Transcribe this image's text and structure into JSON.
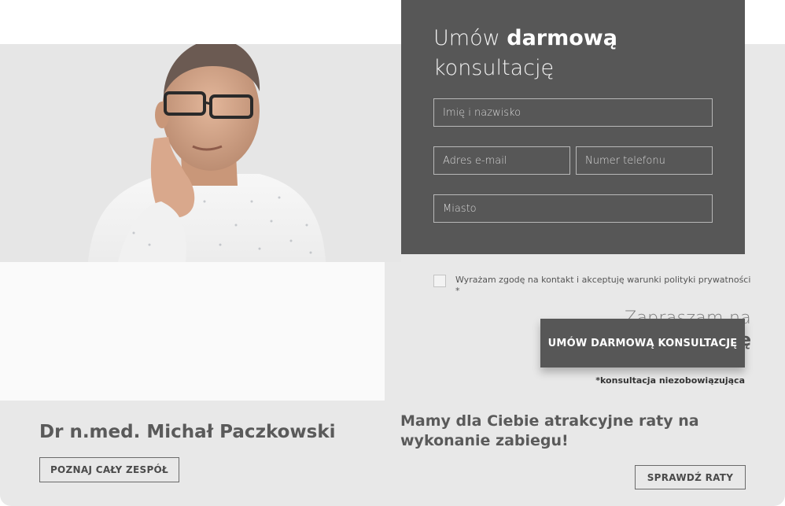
{
  "hero": {
    "invite_line1": "Zapraszam na",
    "invite_line2": "darmową konsultację",
    "doctor_name": "Dr n.med. Michał Paczkowski",
    "team_button": "POZNAJ CAŁY ZESPÓŁ"
  },
  "form": {
    "title_light": "Umów ",
    "title_bold": "darmową",
    "title_line2": "konsultację",
    "name_placeholder": "Imię i nazwisko",
    "email_placeholder": "Adres e-mail",
    "phone_placeholder": "Numer telefonu",
    "city_placeholder": "Miasto",
    "consent_text": "Wyrażam zgodę na kontakt i akceptuję warunki polityki prywatności *",
    "consent_checked": false,
    "submit_label": "UMÓW DARMOWĄ KONSULTACJĘ",
    "note": "*konsultacja niezobowiązująca"
  },
  "financing": {
    "text": "Mamy dla Ciebie atrakcyjne raty na wykonanie zabiegu!",
    "button": "SPRAWDŹ RATY"
  },
  "colors": {
    "form_bg": "#575757",
    "page_bg": "#e8e8e8",
    "panel_bg": "#fafafa",
    "text_dark": "#5a5a5a"
  }
}
